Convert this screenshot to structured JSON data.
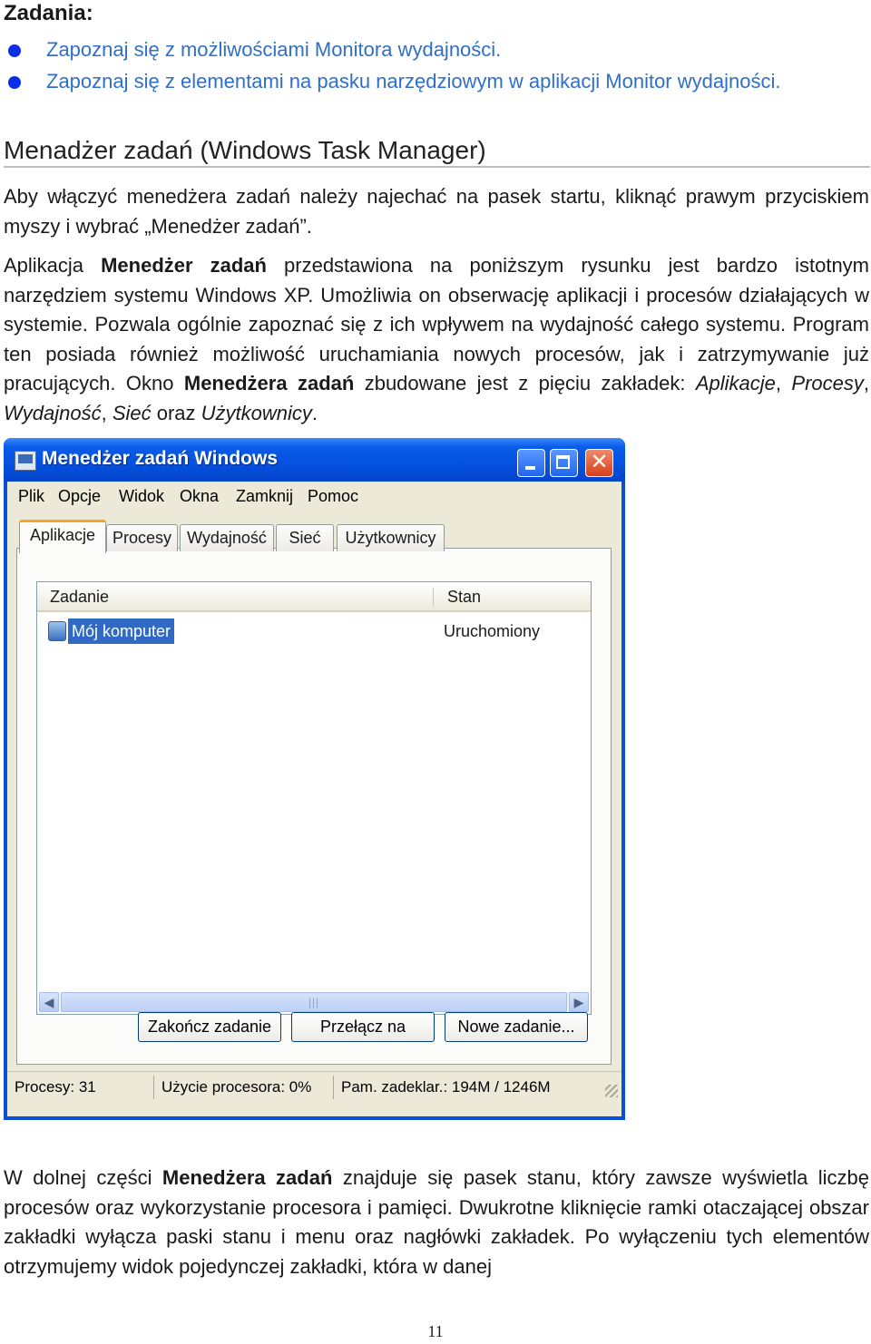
{
  "doc": {
    "tasks_heading": "Zadania:",
    "bullets": [
      "Zapoznaj się z możliwościami Monitora wydajności.",
      "Zapoznaj się z elementami na pasku narzędziowym w aplikacji Monitor wydajności."
    ],
    "section_title": "Menadżer zadań (Windows Task Manager)",
    "p1": "Aby włączyć menedżera zadań należy najechać na pasek startu, kliknąć prawym przyciskiem myszy i wybrać „Menedżer zadań”.",
    "p2": {
      "t1": "Aplikacja ",
      "b1": "Menedżer zadań",
      "t2": " przedstawiona na poniższym rysunku jest bardzo istotnym narzędziem systemu Windows XP. Umożliwia on obserwację aplikacji i procesów działających w systemie. Pozwala ogólnie zapoznać się z ich wpływem na wydajność całego systemu. Program ten posiada również możliwość uruchamiania nowych procesów, jak i zatrzymywanie już pracujących. Okno ",
      "b2": "Menedżera zadań",
      "t3": " zbudowane jest z pięciu zakładek: ",
      "i1": "Aplikacje",
      "t4": ", ",
      "i2": "Procesy",
      "t5": ", ",
      "i3": "Wydajność",
      "t6": ", ",
      "i4": "Sieć",
      "t7": " oraz ",
      "i5": "Użytkownicy",
      "t8": "."
    },
    "p3": {
      "t1": "W dolnej części ",
      "b1": "Menedżera zadań",
      "t2": " znajduje się pasek stanu, który zawsze wyświetla liczbę procesów oraz wykorzystanie procesora i pamięci. Dwukrotne kliknięcie ramki otaczającej obszar zakładki wyłącza paski stanu i menu oraz nagłówki zakładek. Po wyłączeniu tych elementów otrzymujemy widok pojedynczej zakładki, która w danej"
    },
    "page_number": "11"
  },
  "window": {
    "title": "Menedżer zadań Windows",
    "menu": [
      "Plik",
      "Opcje",
      "Widok",
      "Okna",
      "Zamknij",
      "Pomoc"
    ],
    "tabs": [
      "Aplikacje",
      "Procesy",
      "Wydajność",
      "Sieć",
      "Użytkownicy"
    ],
    "columns": {
      "task": "Zadanie",
      "status": "Stan"
    },
    "rows": [
      {
        "name": "Mój komputer",
        "status": "Uruchomiony"
      }
    ],
    "buttons": {
      "end_task": "Zakończ zadanie",
      "switch_to": "Przełącz na",
      "new_task": "Nowe zadanie..."
    },
    "statusbar": {
      "processes": "Procesy: 31",
      "cpu": "Użycie procesora: 0%",
      "commit": "Pam. zadeklar.: 194M / 1246M"
    },
    "colors": {
      "title_blue": "#0551e0",
      "selection": "#316ac5",
      "active_tab_accent": "#f5a623",
      "close_red": "#d6401c",
      "bullet_text": "#2f6fc8"
    }
  }
}
